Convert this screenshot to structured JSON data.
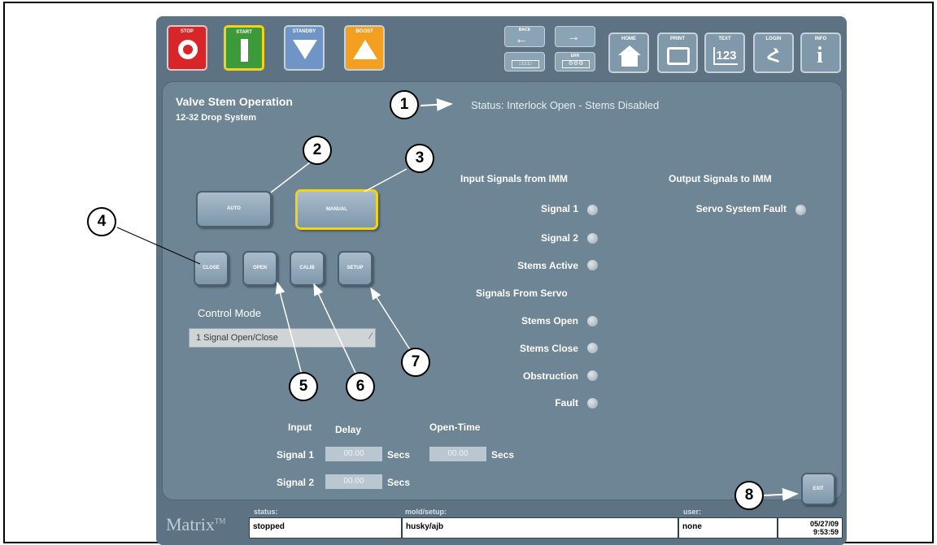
{
  "toolbar": {
    "stop": "STOP",
    "start": "START",
    "standby": "STANDBY",
    "boost": "BOOST",
    "back": "BACK",
    "forward": "",
    "nav_left_bottom": "",
    "nav_right_bottom": "ERR",
    "home": "HOME",
    "print": "PRINT",
    "text": "TEXT",
    "text_icon": "123",
    "login": "LOGIN",
    "info": "INFO"
  },
  "page": {
    "title": "Valve Stem Operation",
    "subtitle": "12-32 Drop System",
    "status": "Status:  Interlock Open - Stems Disabled"
  },
  "mode_buttons": {
    "auto": "AUTO",
    "manual": "MANUAL"
  },
  "action_buttons": {
    "close": "CLOSE",
    "open": "OPEN",
    "calib": "CALIB",
    "setup": "SETUP"
  },
  "control_mode": {
    "label": "Control Mode",
    "value": "1 Signal Open/Close"
  },
  "inputs_section": {
    "title": "Input Signals from IMM",
    "signals": [
      "Signal 1",
      "Signal 2",
      "Stems Active"
    ]
  },
  "servo_section": {
    "title": "Signals From Servo",
    "signals": [
      "Stems Open",
      "Stems Close",
      "Obstruction",
      "Fault"
    ]
  },
  "outputs_section": {
    "title": "Output Signals to IMM",
    "signals": [
      "Servo System Fault"
    ]
  },
  "timing": {
    "headers": {
      "input": "Input",
      "delay": "Delay",
      "open_time": "Open-Time"
    },
    "rows": [
      {
        "label": "Signal 1",
        "delay": "00.00",
        "delay_unit": "Secs",
        "open_time": "00.00",
        "open_unit": "Secs"
      },
      {
        "label": "Signal 2",
        "delay": "00.00",
        "delay_unit": "Secs"
      }
    ]
  },
  "exit_label": "EXIT",
  "status_bar": {
    "brand": "Matrix",
    "brand_tm": "TM",
    "status_label": "status:",
    "status_value": "stopped",
    "mold_label": "mold/setup:",
    "mold_value": "husky/ajb",
    "user_label": "user:",
    "user_value": "none",
    "date": "05/27/09",
    "time": "9:53:59"
  },
  "callouts": [
    "1",
    "2",
    "3",
    "4",
    "5",
    "6",
    "7",
    "8"
  ],
  "colors": {
    "stop": "#d8252a",
    "start": "#3d9a3a",
    "standby": "#6f95c6",
    "boost": "#f3a020",
    "highlight": "#f2d21a",
    "panel": "#6d8595"
  }
}
